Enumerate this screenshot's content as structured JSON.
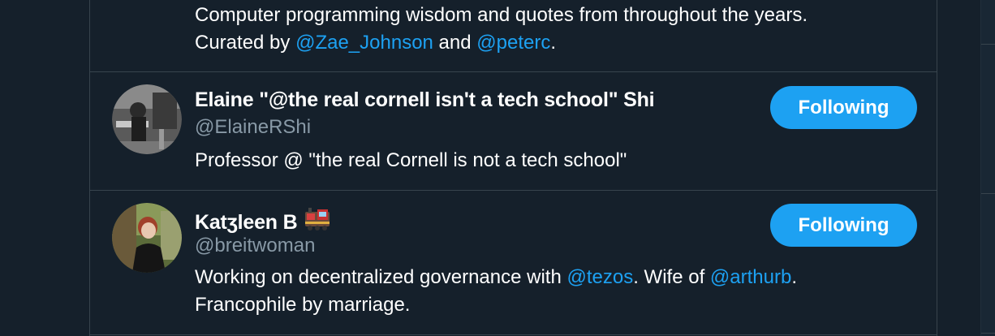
{
  "users": [
    {
      "bio_parts": [
        {
          "text": "Computer programming wisdom and quotes from throughout the years.",
          "link": false
        },
        {
          "text": "Curated by ",
          "link": false
        },
        {
          "text": "@Zae_Johnson",
          "link": true
        },
        {
          "text": " and ",
          "link": false
        },
        {
          "text": "@peterc",
          "link": true
        },
        {
          "text": ".",
          "link": false
        }
      ]
    },
    {
      "name": "Elaine \"@the real cornell isn't a tech school\" Shi",
      "handle": "@ElaineRShi",
      "button_label": "Following",
      "bio": "Professor @ \"the real Cornell is not a tech school\""
    },
    {
      "name": "Katʒleen B",
      "name_icon": "train-icon",
      "handle": "@breitwoman",
      "button_label": "Following",
      "bio_line1": {
        "pre": "Working on decentralized governance with ",
        "link1": "@tezos",
        "mid": ". Wife of ",
        "link2": "@arthurb",
        "post": "."
      },
      "bio_line2": "Francophile by marriage."
    }
  ],
  "colors": {
    "background": "#15202b",
    "border": "#38444d",
    "accent": "#1da1f2",
    "secondary_text": "#8899a6"
  }
}
